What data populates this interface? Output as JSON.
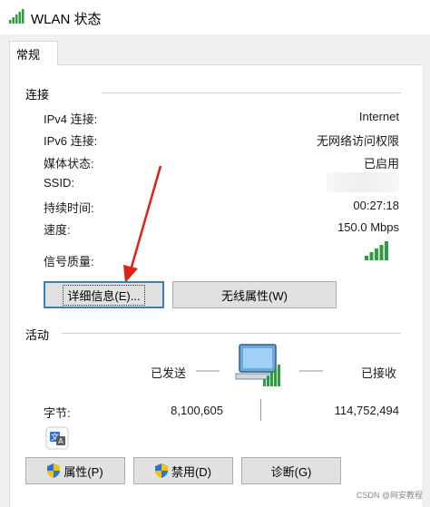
{
  "window": {
    "title": "WLAN 状态",
    "icon": "wifi-signal-icon"
  },
  "tabs": [
    {
      "label": "常规"
    }
  ],
  "connection": {
    "heading": "连接",
    "rows": [
      {
        "label": "IPv4 连接:",
        "value": "Internet"
      },
      {
        "label": "IPv6 连接:",
        "value": "无网络访问权限"
      },
      {
        "label": "媒体状态:",
        "value": "已启用"
      },
      {
        "label": "SSID:",
        "value": ""
      },
      {
        "label": "持续时间:",
        "value": "00:27:18"
      },
      {
        "label": "速度:",
        "value": "150.0 Mbps"
      },
      {
        "label": "信号质量:",
        "value": ""
      }
    ],
    "signal_bars_level": 5,
    "details_button": "详细信息(E)...",
    "wireless_props_button": "无线属性(W)"
  },
  "activity": {
    "heading": "活动",
    "sent_label": "已发送",
    "received_label": "已接收",
    "bytes_label": "字节:",
    "bytes_sent": "8,100,605",
    "bytes_received": "114,752,494"
  },
  "bottom_buttons": {
    "properties": "属性(P)",
    "disable": "禁用(D)",
    "diagnose": "诊断(G)"
  },
  "watermark": "CSDN @网安教程",
  "colors": {
    "signal_green": "#2e9d3f",
    "annotation_arrow": "#e0201b",
    "focus_blue": "#3c7fb1"
  }
}
